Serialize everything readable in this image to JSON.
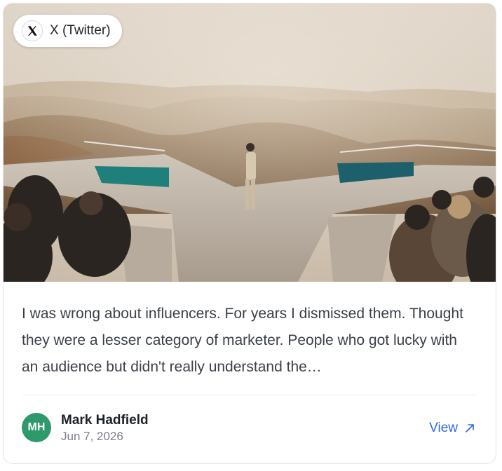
{
  "source": {
    "label": "X (Twitter)",
    "icon": "x-logo-icon"
  },
  "post": {
    "text": "I was wrong about influencers. For years I dismissed them. Thought they were a lesser category of marketer. People who got lucky with an audience but didn't really understand the…"
  },
  "author": {
    "initials": "MH",
    "name": "Mark Hadfield",
    "date": "Jun 7, 2026"
  },
  "action": {
    "view_label": "View",
    "icon": "external-arrow-icon"
  },
  "colors": {
    "avatar": "#2e9a6c",
    "link": "#2f6bd8"
  }
}
